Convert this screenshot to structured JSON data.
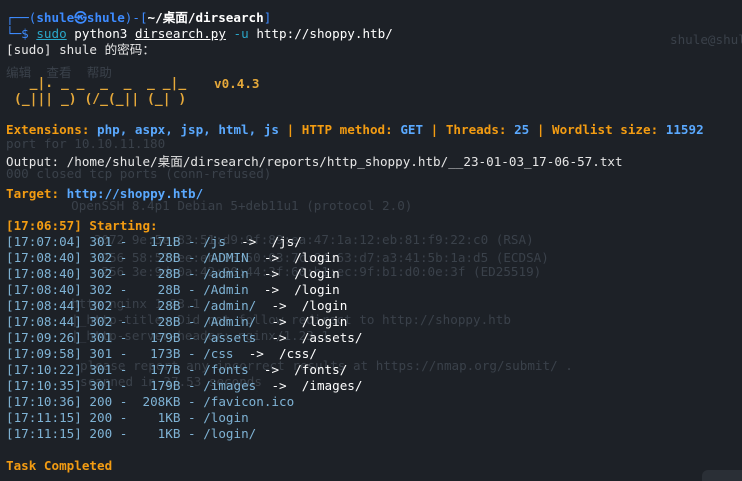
{
  "prompt": {
    "user": "shule",
    "host": "shule",
    "path": "~/桌面/dirsearch",
    "command_sudo": "sudo",
    "command_rest": "python3",
    "script": "dirsearch.py",
    "flag": "-u",
    "url": "http://shoppy.htb/"
  },
  "sudo_prompt": "[sudo] shule 的密码：",
  "banner": {
    "art_top": "  _|. _ _  _  _  _ _|_",
    "art_bottom": "(_||| _) (/_(_|| (_| )",
    "version": "v0.4.3"
  },
  "config": {
    "ext_label": "Extensions:",
    "ext_value": "php, aspx, jsp, html, js",
    "method_label": "HTTP method:",
    "method_value": "GET",
    "threads_label": "Threads:",
    "threads_value": "25",
    "wordlist_label": "Wordlist size:",
    "wordlist_value": "11592"
  },
  "output_line": "Output: /home/shule/桌面/dirsearch/reports/http_shoppy.htb/__23-01-03_17-06-57.txt",
  "target_label": "Target:",
  "target_value": "http://shoppy.htb/",
  "starting": "[17:06:57] Starting:",
  "results": [
    {
      "time": "[17:07:04]",
      "code": "301",
      "size": "171B",
      "path": "/js",
      "redirect": "/js/"
    },
    {
      "time": "[17:08:40]",
      "code": "302",
      "size": "28B",
      "path": "/ADMIN",
      "redirect": "/login"
    },
    {
      "time": "[17:08:40]",
      "code": "302",
      "size": "28B",
      "path": "/admin",
      "redirect": "/login"
    },
    {
      "time": "[17:08:40]",
      "code": "302",
      "size": "28B",
      "path": "/Admin",
      "redirect": "/login"
    },
    {
      "time": "[17:08:44]",
      "code": "302",
      "size": "28B",
      "path": "/admin/",
      "redirect": "/login"
    },
    {
      "time": "[17:08:44]",
      "code": "302",
      "size": "28B",
      "path": "/Admin/",
      "redirect": "/login"
    },
    {
      "time": "[17:09:26]",
      "code": "301",
      "size": "179B",
      "path": "/assets",
      "redirect": "/assets/"
    },
    {
      "time": "[17:09:58]",
      "code": "301",
      "size": "173B",
      "path": "/css",
      "redirect": "/css/"
    },
    {
      "time": "[17:10:22]",
      "code": "301",
      "size": "177B",
      "path": "/fonts",
      "redirect": "/fonts/"
    },
    {
      "time": "[17:10:35]",
      "code": "301",
      "size": "179B",
      "path": "/images",
      "redirect": "/images/"
    },
    {
      "time": "[17:10:36]",
      "code": "200",
      "size": "208KB",
      "path": "/favicon.ico",
      "redirect": ""
    },
    {
      "time": "[17:11:15]",
      "code": "200",
      "size": "1KB",
      "path": "/login",
      "redirect": ""
    },
    {
      "time": "[17:11:15]",
      "code": "200",
      "size": "1KB",
      "path": "/login/",
      "redirect": ""
    }
  ],
  "completed": "Task Completed",
  "ghost_text": {
    "menu": "编辑  查看  帮助",
    "l1": "port for 10.10.11.180",
    "l2": "000 closed tcp ports (conn-refused)",
    "l3": "  OpenSSH 8.4p1 Debian 5+deb11u1 (protocol 2.0)",
    "l4": "     3072 9e:5e:83:51:d9:9f:89:ea:47:1a:12:eb:81:f9:22:c0 (RSA)",
    "l5": "      256 58:57:ee:eb:06:50:03:7c:84:63:d7:a3:41:5b:1a:d5 (ECDSA)",
    "l6": "      256 3e:9d:0a:42:90:44:3f:60:b1:ec:9f:b1:d0:0e:3f (ED25519)",
    "l7": "  http nginx 1.23.1",
    "l8": "  |_http-title: Did not follow redirect to http://shoppy.htb",
    "l9": "  |_http-server-header: nginx/1.23.1",
    "l10": "please report any incorrect results at https://nmap.org/submit/ .",
    "l11": "scanned in 37.53 seconds",
    "r1": "shule@shule"
  }
}
